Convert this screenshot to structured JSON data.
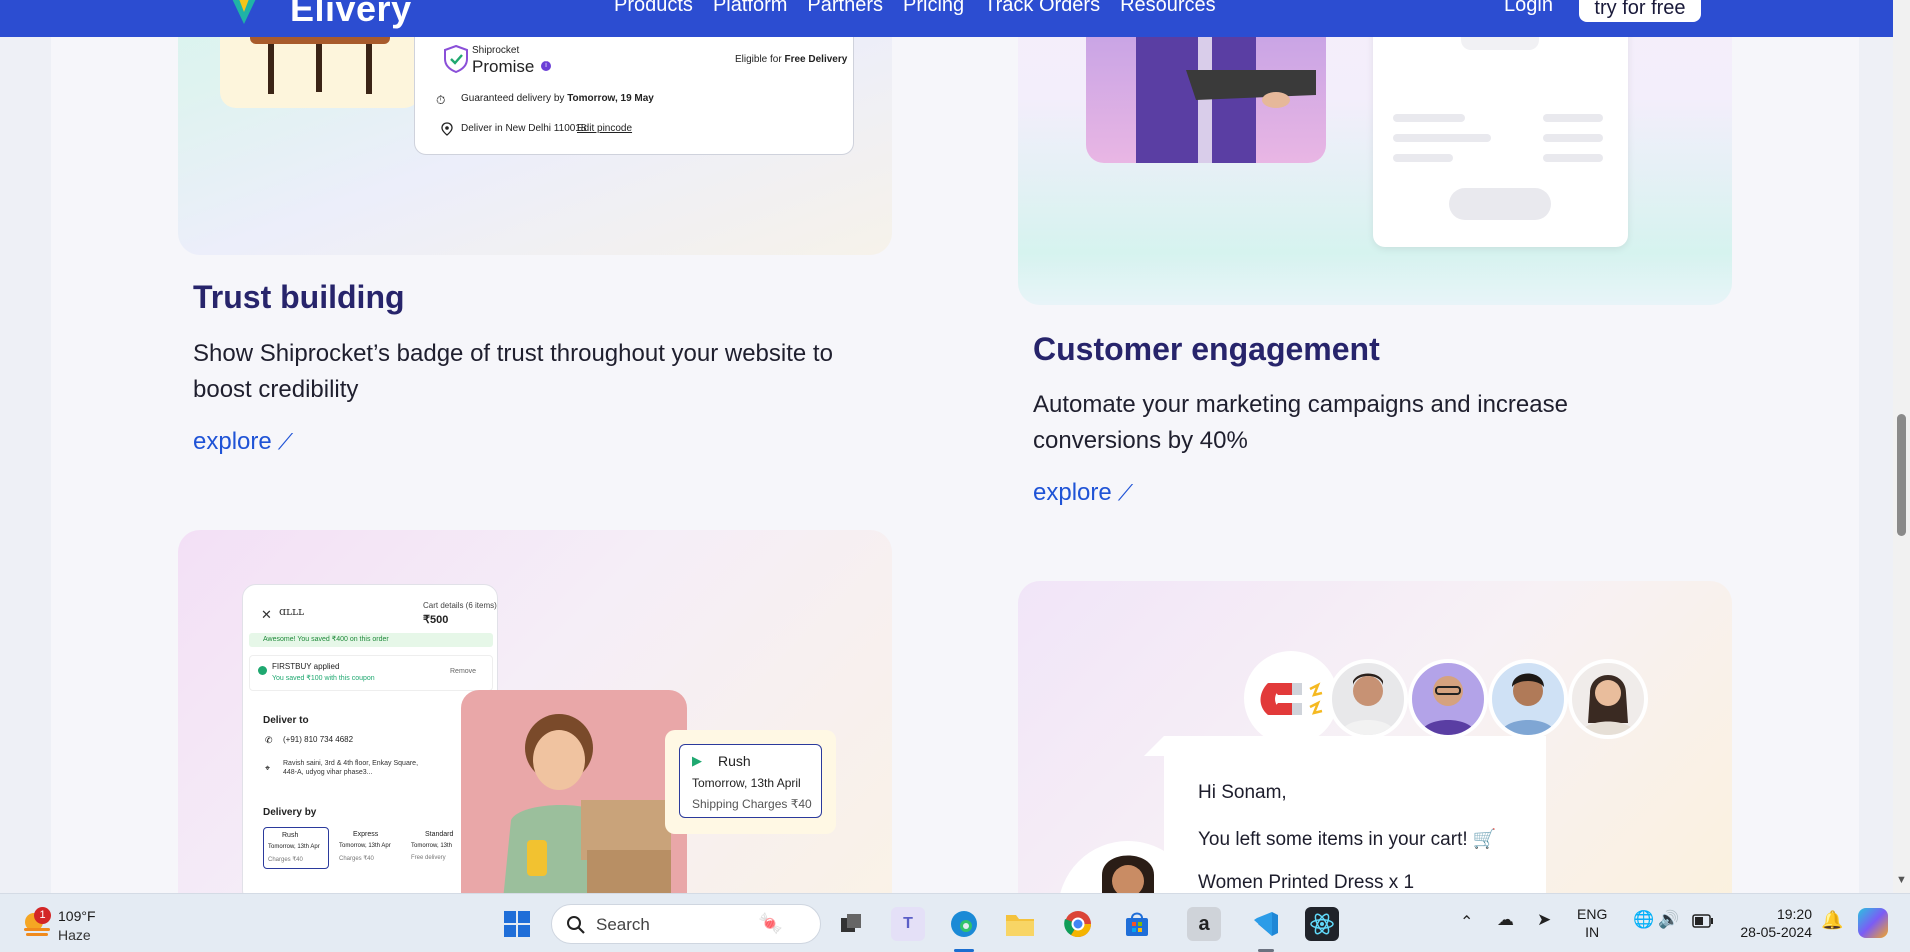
{
  "nav": {
    "brand": "Elivery",
    "links": [
      "Products",
      "Platform",
      "Partners",
      "Pricing",
      "Track Orders",
      "Resources"
    ],
    "login": "Login",
    "cta": "try for free"
  },
  "promise_widget": {
    "brand_small": "Shiprocket",
    "brand_big": "Promise",
    "eligible_prefix": "Eligible for",
    "eligible_bold": "Free Delivery",
    "guaranteed_prefix": "Guaranteed delivery by",
    "guaranteed_date": "Tomorrow,  19 May",
    "deliver_in": "Deliver in New Delhi 110018",
    "edit_pincode": "Edit pincode"
  },
  "cards": {
    "trust": {
      "title": "Trust building",
      "desc": "Show Shiprocket’s badge of trust throughout your website to boost credibility",
      "explore": "explore"
    },
    "engagement": {
      "title": "Customer engagement",
      "desc": "Automate your marketing campaigns and increase conversions by 40%",
      "explore": "explore"
    }
  },
  "checkout": {
    "cart_details": "Cart details (6 items)",
    "cart_total": "₹500",
    "saved_banner": "Awesome! You saved ₹400 on this order",
    "coupon": "FIRSTBUY applied",
    "coupon_saved": "You saved ₹100 with this coupon",
    "remove": "Remove",
    "deliver_to": "Deliver to",
    "phone": "(+91) 810 734 4682",
    "address": "Ravish saini, 3rd & 4th floor, Enkay Square, 448-A, udyog vihar phase3...",
    "delivery_by": "Delivery by",
    "options": [
      {
        "name": "Rush",
        "date": "Tomorrow, 13th Apr",
        "charge": "Charges ₹40"
      },
      {
        "name": "Express",
        "date": "Tomorrow, 13th Apr",
        "charge": "Charges ₹40"
      },
      {
        "name": "Standard",
        "date": "Tomorrow, 13th",
        "charge": "Free delivery"
      }
    ]
  },
  "rush": {
    "title": "Rush",
    "date": "Tomorrow, 13th April",
    "charges": "Shipping Charges ₹40"
  },
  "chat": {
    "greeting": "Hi Sonam,",
    "line2": "You left some items in your cart! 🛒",
    "line3": "Women Printed Dress x 1"
  },
  "taskbar": {
    "weather_badge": "1",
    "temp": "109°F",
    "condition": "Haze",
    "search": "Search",
    "lang_top": "ENG",
    "lang_bottom": "IN",
    "time": "19:20",
    "date": "28-05-2024"
  },
  "colors": {
    "nav_bg": "#2c4dd1",
    "title": "#27246b",
    "link": "#1f53d6"
  }
}
